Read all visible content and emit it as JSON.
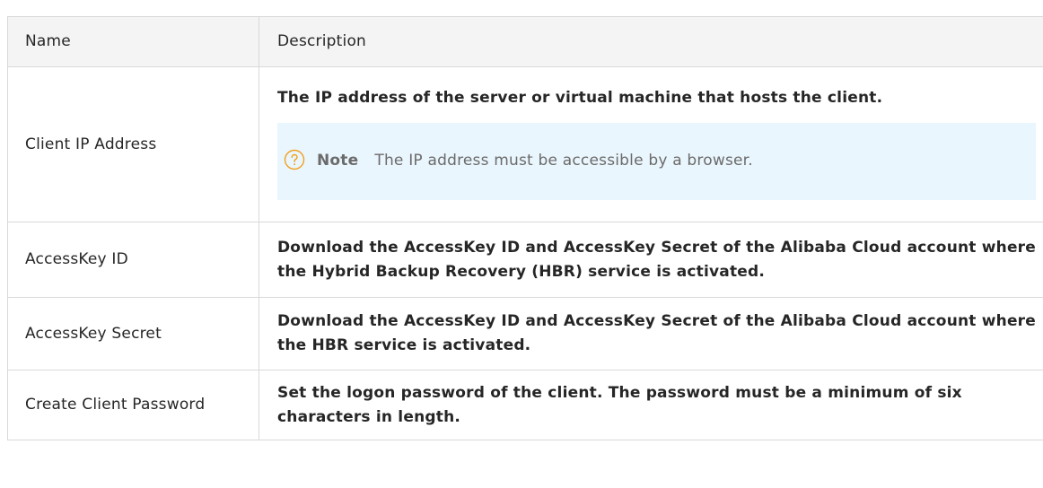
{
  "table": {
    "headers": {
      "name": "Name",
      "description": "Description"
    },
    "rows": [
      {
        "name": "Client IP Address",
        "description": "The IP address of the server or virtual machine that hosts the client.",
        "note": {
          "icon": "question-circle-icon",
          "label": "Note",
          "text": "The IP address must be accessible by a browser."
        }
      },
      {
        "name": "AccessKey ID",
        "description": "Download the AccessKey ID and AccessKey Secret of the Alibaba Cloud account where the Hybrid Backup Recovery (HBR) service is activated."
      },
      {
        "name": "AccessKey Secret",
        "description": "Download the AccessKey ID and AccessKey Secret of the Alibaba Cloud account where the HBR service is activated."
      },
      {
        "name": "Create Client Password",
        "description": "Set the logon password of the client. The password must be a minimum of six characters in length."
      }
    ]
  },
  "colors": {
    "note_background": "#eaf6fd",
    "note_icon": "#f0a020",
    "border": "#d9d9d9",
    "header_background": "#f4f4f4"
  }
}
